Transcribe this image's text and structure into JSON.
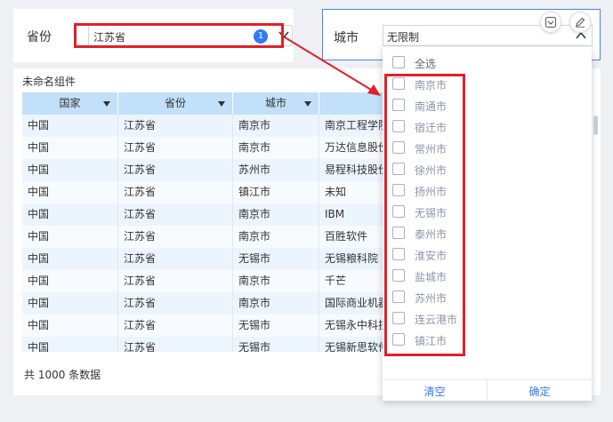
{
  "province_filter": {
    "label": "省份",
    "value": "江苏省",
    "badge": "1"
  },
  "city_filter": {
    "label": "城市",
    "value": "无限制"
  },
  "table": {
    "title": "未命名组件",
    "headers": [
      "国家",
      "省份",
      "城市",
      ""
    ],
    "rows": [
      [
        "中国",
        "江苏省",
        "南京市",
        "南京工程学院"
      ],
      [
        "中国",
        "江苏省",
        "南京市",
        "万达信息股份"
      ],
      [
        "中国",
        "江苏省",
        "苏州市",
        "易程科技股份"
      ],
      [
        "中国",
        "江苏省",
        "镇江市",
        "未知"
      ],
      [
        "中国",
        "江苏省",
        "南京市",
        "IBM"
      ],
      [
        "中国",
        "江苏省",
        "南京市",
        "百胜软件"
      ],
      [
        "中国",
        "江苏省",
        "无锡市",
        "无锡粮科院"
      ],
      [
        "中国",
        "江苏省",
        "南京市",
        "千芒"
      ],
      [
        "中国",
        "江苏省",
        "南京市",
        "国际商业机器"
      ],
      [
        "中国",
        "江苏省",
        "无锡市",
        "无锡永中科技"
      ],
      [
        "中国",
        "江苏省",
        "无锡市",
        "无锡新思软件"
      ]
    ],
    "footer": "共 1000 条数据"
  },
  "dropdown": {
    "select_all": "全选",
    "options": [
      "南京市",
      "南通市",
      "宿迁市",
      "常州市",
      "徐州市",
      "扬州市",
      "无锡市",
      "泰州市",
      "淮安市",
      "盐城市",
      "苏州市",
      "连云港市",
      "镇江市"
    ],
    "clear": "清空",
    "confirm": "确定"
  },
  "colors": {
    "accent": "#2f7bf5",
    "highlight": "#e0202a",
    "header_bg": "#c3e0fb"
  }
}
